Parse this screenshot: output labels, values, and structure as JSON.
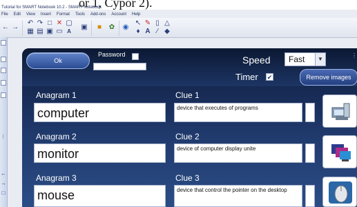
{
  "top_caption": "or 1, Cypor 2).",
  "window": {
    "title": "Tutorial for SMART Notebook 10.2 - SMART Notebook"
  },
  "menubar": [
    "File",
    "Edit",
    "View",
    "Insert",
    "Format",
    "Tools",
    "Add-ons",
    "Account",
    "Help"
  ],
  "toolbar": {
    "icons": [
      "back-arrow-icon",
      "forward-arrow-icon",
      "undo-icon",
      "redo-icon",
      "paste-icon",
      "delete-icon",
      "screen-icon",
      "table-icon",
      "text-format-icon",
      "camera-icon",
      "document-icon",
      "smart-icon",
      "select-pointer-icon",
      "pen-icon",
      "eraser-icon",
      "shape-icon",
      "text-icon",
      "fill-icon"
    ]
  },
  "form": {
    "ok_label": "Ok",
    "password_label": "Password",
    "speed_label": "Speed",
    "speed_value": "Fast",
    "timer_label": "Timer",
    "timer_checked": true,
    "remove_images_label": "Remove images",
    "rows": [
      {
        "anagram_label": "Anagram 1",
        "anagram_value": "computer",
        "clue_label": "Clue 1",
        "clue_value": "device that executes of programs",
        "image_icon": "computer-image-icon"
      },
      {
        "anagram_label": "Anagram 2",
        "anagram_value": "monitor",
        "clue_label": "Clue 2",
        "clue_value": "device of computer display unite",
        "image_icon": "monitor-image-icon"
      },
      {
        "anagram_label": "Anagram 3",
        "anagram_value": "mouse",
        "clue_label": "Clue 3",
        "clue_value": "device that control the pointer on the desktop",
        "image_icon": "mouse-image-icon"
      }
    ]
  }
}
